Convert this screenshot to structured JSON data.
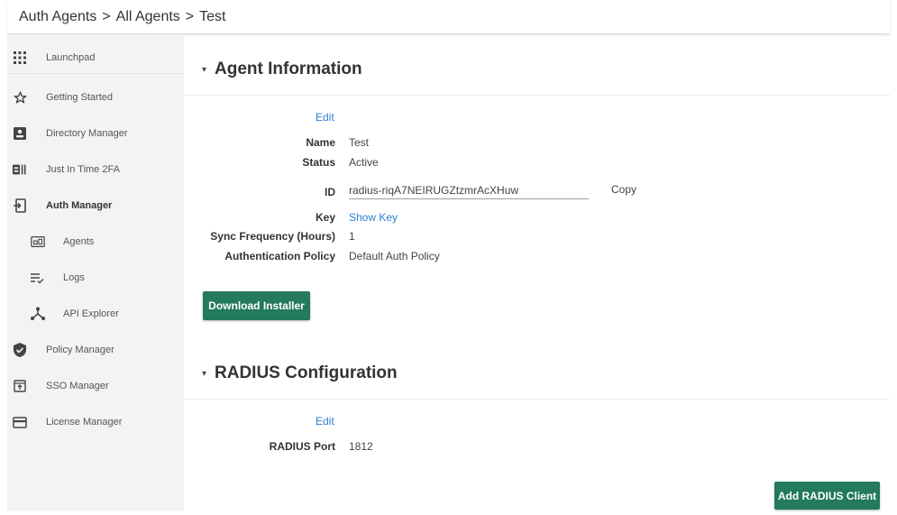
{
  "breadcrumb": {
    "items": [
      "Auth Agents",
      "All Agents",
      "Test"
    ],
    "separator": ">"
  },
  "sidebar": {
    "items": [
      {
        "label": "Launchpad",
        "icon": "grid-icon"
      },
      {
        "label": "Getting Started",
        "icon": "star-icon"
      },
      {
        "label": "Directory Manager",
        "icon": "contact-card-icon"
      },
      {
        "label": "Just In Time 2FA",
        "icon": "id-badge-icon"
      },
      {
        "label": "Auth Manager",
        "icon": "login-door-icon",
        "active": true
      },
      {
        "label": "Agents",
        "icon": "agents-icon",
        "sub": true
      },
      {
        "label": "Logs",
        "icon": "list-check-icon",
        "sub": true
      },
      {
        "label": "API Explorer",
        "icon": "network-icon",
        "sub": true
      },
      {
        "label": "Policy Manager",
        "icon": "shield-check-icon"
      },
      {
        "label": "SSO Manager",
        "icon": "window-login-icon"
      },
      {
        "label": "License Manager",
        "icon": "card-icon"
      }
    ]
  },
  "agent_info": {
    "title": "Agent Information",
    "edit_label": "Edit",
    "fields": {
      "name_label": "Name",
      "name_value": "Test",
      "status_label": "Status",
      "status_value": "Active",
      "id_label": "ID",
      "id_value": "radius-riqA7NEIRUGZtzmrAcXHuw",
      "copy_label": "Copy",
      "key_label": "Key",
      "key_link": "Show Key",
      "sync_label": "Sync Frequency (Hours)",
      "sync_value": "1",
      "policy_label": "Authentication Policy",
      "policy_value": "Default Auth Policy"
    },
    "download_button": "Download Installer"
  },
  "radius": {
    "title": "RADIUS Configuration",
    "edit_label": "Edit",
    "port_label": "RADIUS Port",
    "port_value": "1812",
    "add_button": "Add RADIUS Client"
  },
  "colors": {
    "accent_button": "#237a5e",
    "link": "#2b7fd4",
    "sidebar_bg": "#f3f3f3"
  }
}
